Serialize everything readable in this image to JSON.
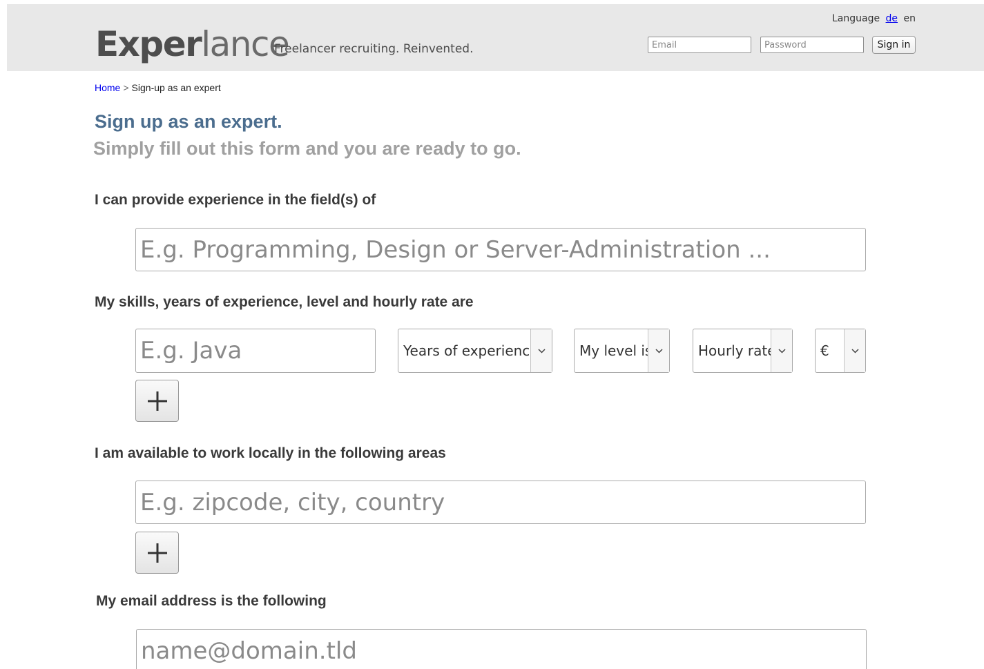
{
  "header": {
    "logo_part1": "Exper",
    "logo_part2": "lance",
    "tagline": "Freelancer recruiting. Reinvented.",
    "language_label": "Language",
    "lang_de": "de",
    "lang_en": "en",
    "email_placeholder": "Email",
    "password_placeholder": "Password",
    "signin_label": "Sign in"
  },
  "breadcrumb": {
    "home": "Home",
    "separator": ">",
    "current": "Sign-up as an expert"
  },
  "page": {
    "title": "Sign up as an expert.",
    "subtitle": "Simply fill out this form and you are ready to go."
  },
  "form": {
    "fields_label": "I can provide experience in the field(s) of",
    "fields_placeholder": "E.g. Programming, Design or Server-Administration ...",
    "skills_label": "My skills, years of experience, level and hourly rate are",
    "skill_placeholder": "E.g. Java",
    "years_select": "Years of experience",
    "level_select": "My level is",
    "rate_select": "Hourly rate",
    "currency_select": "€",
    "areas_label": "I am available to work locally in the following areas",
    "areas_placeholder": "E.g. zipcode, city, country",
    "email_label": "My email address is the following",
    "email_placeholder": "name@domain.tld"
  },
  "icons": {
    "add": "plus-icon",
    "dropdown": "chevron-down-icon"
  },
  "colors": {
    "header_bg": "#e8e8e8",
    "title": "#4b6d8e",
    "subtitle": "#a0a0a0",
    "link": "#0000ee"
  }
}
